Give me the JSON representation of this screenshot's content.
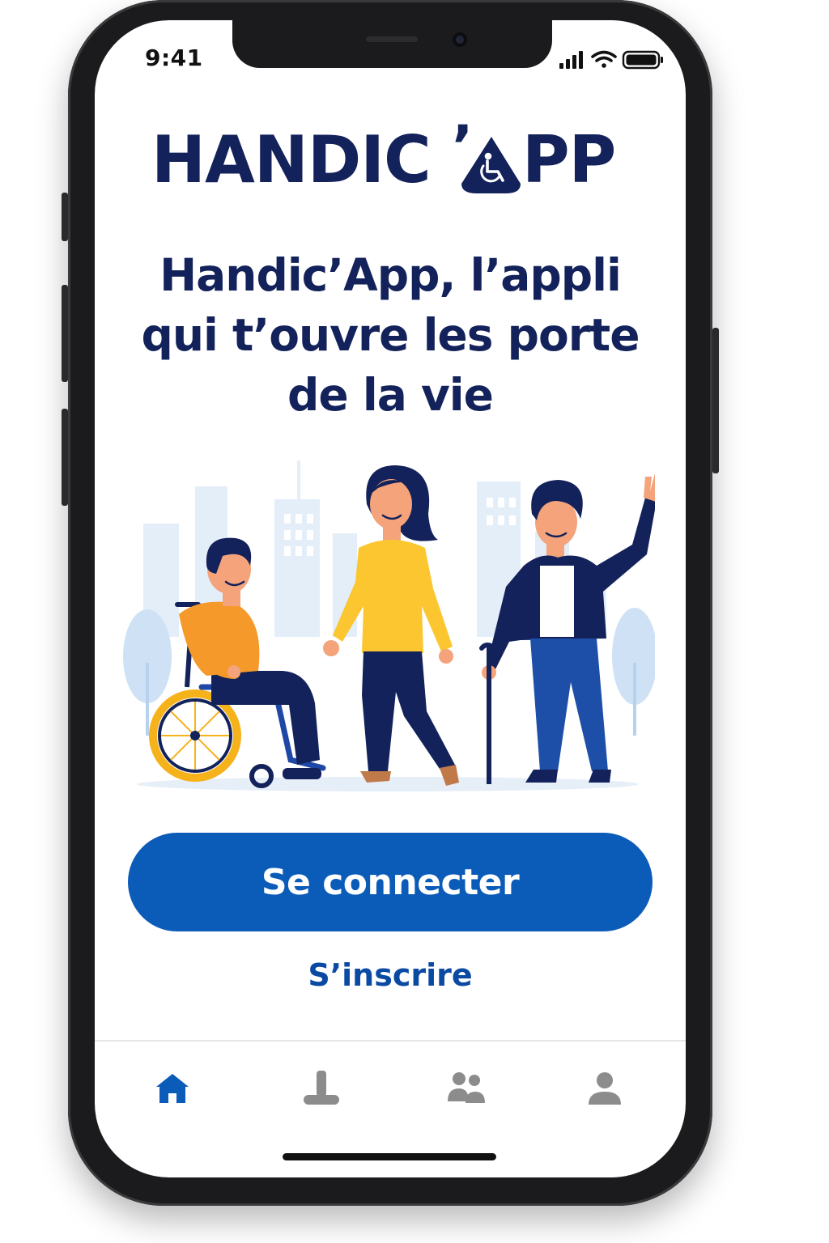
{
  "status_bar": {
    "time": "9:41",
    "icons": [
      "signal-icon",
      "wifi-icon",
      "battery-icon"
    ]
  },
  "brand": {
    "logo_left": "HANDIC",
    "logo_apostrophe": "’",
    "logo_right": "PP",
    "logo_icon": "wheelchair-icon",
    "color": "#13225a"
  },
  "hero": {
    "headline_line1": "Handic’App, l’appli",
    "headline_line2": "qui t’ouvre les porte",
    "headline_line3": "de la vie"
  },
  "actions": {
    "login_label": "Se connecter",
    "signup_label": "S’inscrire",
    "primary_color": "#0b5bb8"
  },
  "tab_bar": {
    "active_index": 0,
    "active_color": "#0b5bb8",
    "inactive_color": "#8c8c8c",
    "items": [
      {
        "icon": "home-icon"
      },
      {
        "icon": "cane-icon"
      },
      {
        "icon": "community-icon"
      },
      {
        "icon": "profile-icon"
      }
    ]
  }
}
